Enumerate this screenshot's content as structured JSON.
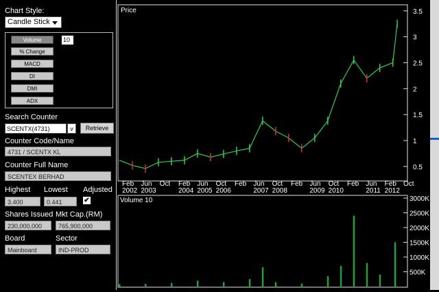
{
  "sidebar": {
    "chart_style_label": "Chart Style:",
    "chart_style_value": "Candle Stick",
    "indicators": [
      {
        "label": "Volume",
        "active": true
      },
      {
        "label": "% Change",
        "active": false
      },
      {
        "label": "MACD",
        "active": false
      },
      {
        "label": "DI",
        "active": false
      },
      {
        "label": "DMI",
        "active": false
      },
      {
        "label": "ADX",
        "active": false
      }
    ],
    "volume_period": "10",
    "search_label": "Search Counter",
    "search_value": "SCENTX(4731)",
    "search_dropdown": "v",
    "retrieve_label": "Retrieve",
    "counter_code_label": "Counter Code/Name",
    "counter_code_value": "4731 / SCENTX KL",
    "full_name_label": "Counter Full Name",
    "full_name_value": "SCENTEX BERHAD",
    "highest_label": "Highest",
    "highest_value": "3.400",
    "lowest_label": "Lowest",
    "lowest_value": "0.441",
    "adjusted_label": "Adjusted",
    "adjusted_checked": "✔",
    "shares_label": "Shares Issued",
    "shares_value": "230,000,000",
    "mktcap_label": "Mkt Cap.(RM)",
    "mktcap_value": "765,900,000",
    "board_label": "Board",
    "board_value": "Mainboard",
    "sector_label": "Sector",
    "sector_value": "IND-PROD"
  },
  "chart_data": [
    {
      "type": "line",
      "title": "Price",
      "x_ticks": [
        {
          "month": "Feb",
          "year": "2002"
        },
        {
          "month": "Jun",
          "year": "2003"
        },
        {
          "month": "Oct",
          "year": ""
        },
        {
          "month": "Feb",
          "year": "2004"
        },
        {
          "month": "Jun",
          "year": "2005"
        },
        {
          "month": "Oct",
          "year": "2006"
        },
        {
          "month": "Feb",
          "year": ""
        },
        {
          "month": "Jun",
          "year": "2007"
        },
        {
          "month": "Oct",
          "year": "2008"
        },
        {
          "month": "Feb",
          "year": ""
        },
        {
          "month": "Jun",
          "year": "2009"
        },
        {
          "month": "Oct",
          "year": "2010"
        },
        {
          "month": "Feb",
          "year": ""
        },
        {
          "month": "Jun",
          "year": "2011"
        },
        {
          "month": "Feb",
          "year": "2012"
        },
        {
          "month": "Oct",
          "year": ""
        }
      ],
      "y_ticks": [
        "0.5",
        "1",
        "1.5",
        "2",
        "2.5",
        "3",
        "3.5"
      ],
      "ylim": [
        0.3,
        3.55
      ],
      "x": [
        "2002-01",
        "2002-07",
        "2003-01",
        "2003-07",
        "2004-01",
        "2004-07",
        "2005-01",
        "2005-07",
        "2006-01",
        "2006-07",
        "2007-01",
        "2007-07",
        "2008-01",
        "2008-07",
        "2009-01",
        "2009-07",
        "2010-01",
        "2010-07",
        "2011-01",
        "2011-07",
        "2012-01",
        "2012-07",
        "2012-09"
      ],
      "values": [
        0.62,
        0.52,
        0.46,
        0.58,
        0.6,
        0.62,
        0.75,
        0.68,
        0.74,
        0.8,
        0.85,
        1.38,
        1.18,
        1.05,
        0.85,
        1.05,
        1.38,
        2.1,
        2.55,
        2.2,
        2.4,
        2.5,
        3.25
      ]
    },
    {
      "type": "bar",
      "title": "Volume 10",
      "y_ticks": [
        "500K",
        "1000K",
        "1500K",
        "2000K",
        "2500K",
        "3000K"
      ],
      "ylim": [
        0,
        3000000
      ],
      "x": [
        "2002-01",
        "2003-01",
        "2004-01",
        "2005-01",
        "2006-01",
        "2007-01",
        "2007-07",
        "2008-01",
        "2009-01",
        "2010-01",
        "2010-07",
        "2011-01",
        "2011-07",
        "2012-01",
        "2012-08"
      ],
      "values": [
        80000,
        90000,
        120000,
        200000,
        150000,
        250000,
        650000,
        150000,
        100000,
        350000,
        700000,
        2400000,
        800000,
        400000,
        1500000
      ]
    }
  ]
}
